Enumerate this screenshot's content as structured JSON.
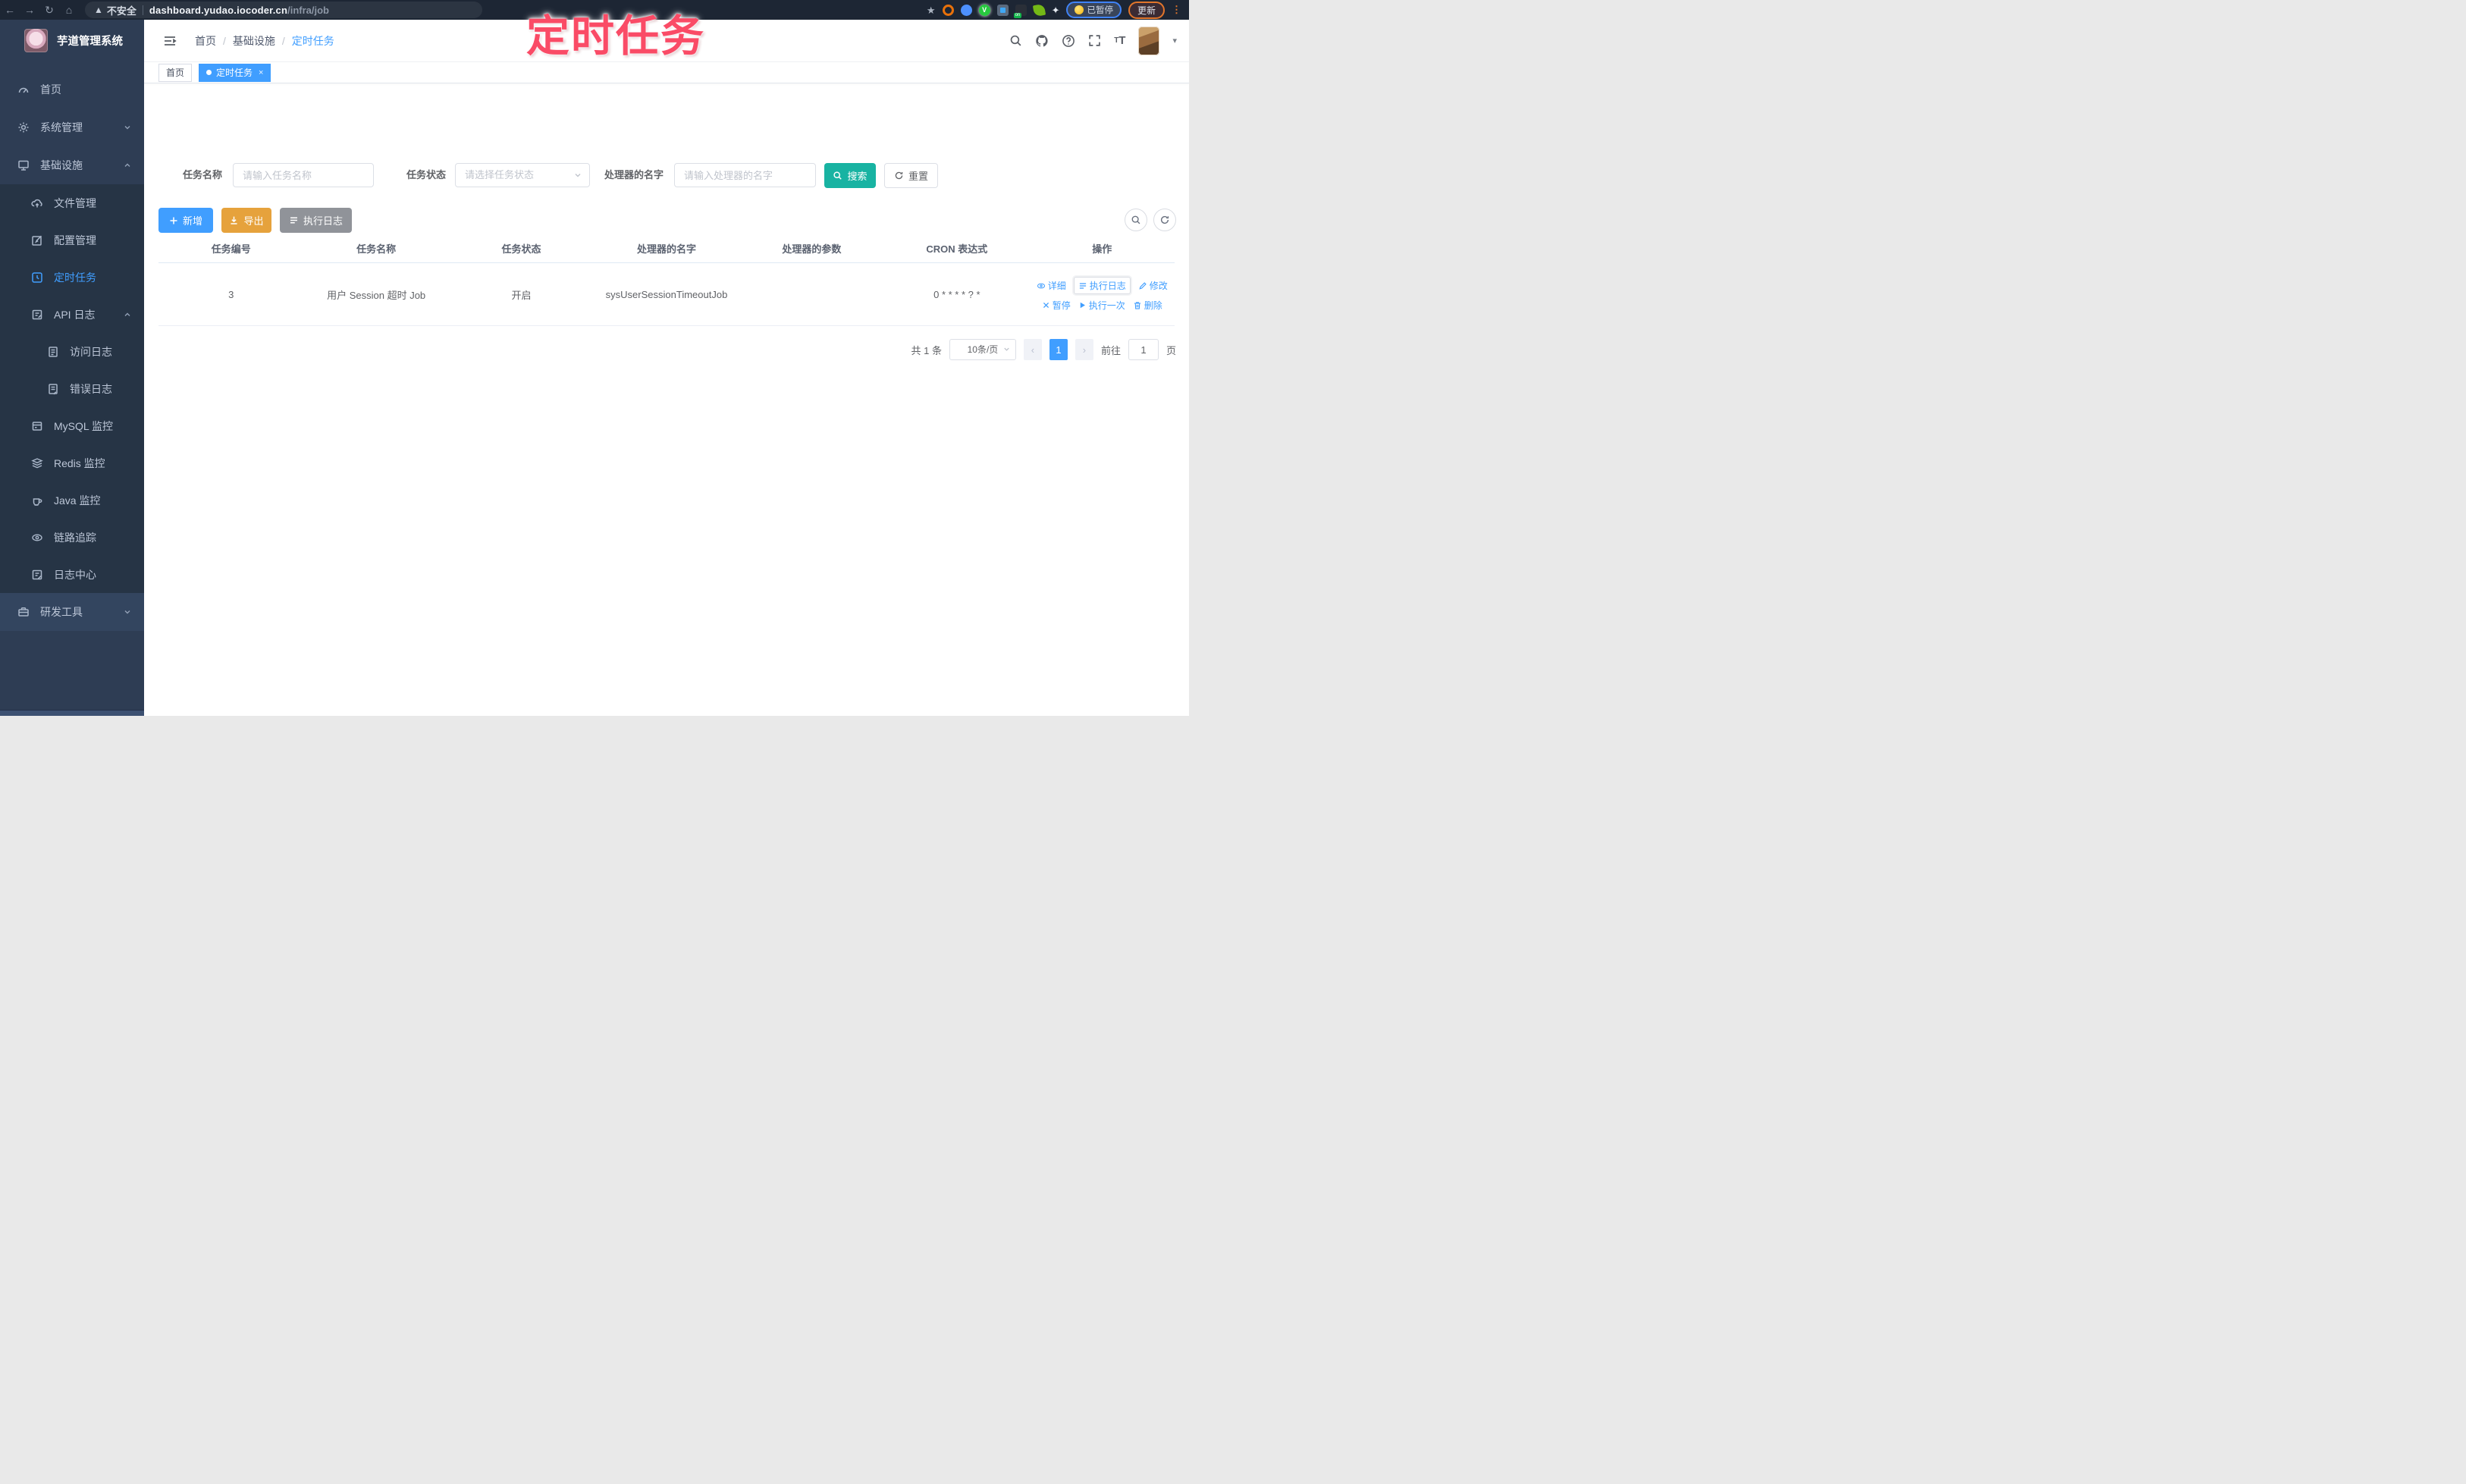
{
  "colors": {
    "accent": "#409eff",
    "search_teal": "#18b3a2",
    "warning": "#e6a23c",
    "info": "#909399",
    "sidebar_bg": "#2e3d54",
    "submenu_bg": "#263445",
    "annotation_pink": "#fa4b66"
  },
  "annotation": {
    "title": "定时任务"
  },
  "browser": {
    "security_label": "不安全",
    "url_host": "dashboard.yudao.iocoder.cn",
    "url_path": "/infra/job",
    "paused_label": "已暂停",
    "update_label": "更新",
    "menu_dots": "⋮"
  },
  "sidebar": {
    "app_title": "芋道管理系统",
    "items": [
      {
        "label": "首页"
      },
      {
        "label": "系统管理"
      },
      {
        "label": "基础设施"
      },
      {
        "label": "文件管理"
      },
      {
        "label": "配置管理"
      },
      {
        "label": "定时任务"
      },
      {
        "label": "API 日志"
      },
      {
        "label": "访问日志"
      },
      {
        "label": "错误日志"
      },
      {
        "label": "MySQL 监控"
      },
      {
        "label": "Redis 监控"
      },
      {
        "label": "Java 监控"
      },
      {
        "label": "链路追踪"
      },
      {
        "label": "日志中心"
      },
      {
        "label": "研发工具"
      }
    ]
  },
  "header": {
    "breadcrumb": [
      "首页",
      "基础设施",
      "定时任务"
    ]
  },
  "tags": {
    "home": "首页",
    "active": "定时任务",
    "close": "×"
  },
  "filters": {
    "name_label": "任务名称",
    "name_placeholder": "请输入任务名称",
    "status_label": "任务状态",
    "status_placeholder": "请选择任务状态",
    "handler_label": "处理器的名字",
    "handler_placeholder": "请输入处理器的名字",
    "search_label": "搜索",
    "reset_label": "重置"
  },
  "toolbar": {
    "add_label": "新增",
    "export_label": "导出",
    "exec_log_label": "执行日志"
  },
  "table": {
    "columns": [
      "任务编号",
      "任务名称",
      "任务状态",
      "处理器的名字",
      "处理器的参数",
      "CRON 表达式",
      "操作"
    ],
    "row": {
      "id": "3",
      "name": "用户 Session 超时 Job",
      "status": "开启",
      "handler": "sysUserSessionTimeoutJob",
      "param": "",
      "cron": "0 * * * * ? *"
    },
    "actions": [
      "详细",
      "执行日志",
      "修改",
      "暂停",
      "执行一次",
      "删除"
    ]
  },
  "pagination": {
    "total": "共 1 条",
    "page_size": "10条/页",
    "page": "1",
    "prev": "‹",
    "next": "›",
    "goto_label": "前往",
    "goto_value": "1",
    "unit_label": "页"
  }
}
